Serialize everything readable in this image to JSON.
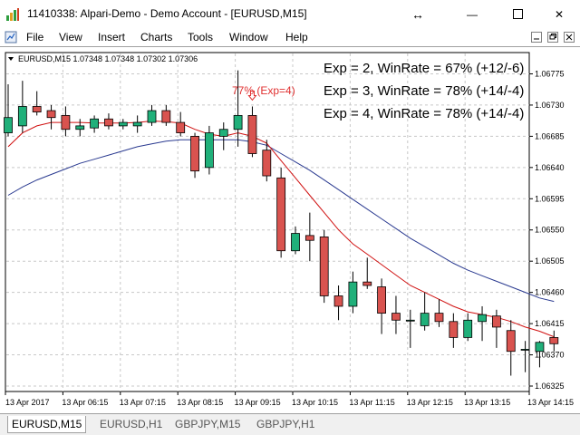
{
  "window": {
    "title": "11410338: Alpari-Demo - Demo Account - [EURUSD,M15]",
    "resize_glyph": "↔",
    "minimize_glyph": "—",
    "close_glyph": "✕"
  },
  "menu": {
    "items": [
      "File",
      "View",
      "Insert",
      "Charts",
      "Tools",
      "Window",
      "Help"
    ]
  },
  "chart": {
    "header": "EURUSD,M15  1.07348 1.07348 1.07302 1.07306",
    "annotation": "77% (Exp=4)",
    "annotation_color": "#e03030",
    "stats": [
      "Exp = 2, WinRate = 67% (+12/-6)",
      "Exp = 3, WinRate = 78% (+14/-4)",
      "Exp = 4, WinRate = 78% (+14/-4)"
    ],
    "colors": {
      "bull": "#20b07a",
      "bear": "#d9534f",
      "fast_ma": "#d01010",
      "slow_ma": "#2a3a90",
      "grid": "#c8c8c8"
    }
  },
  "chart_data": {
    "type": "candlestick",
    "symbol": "EURUSD",
    "timeframe": "M15",
    "ylim": [
      1.06325,
      1.0679
    ],
    "y_ticks": [
      "1.06775",
      "1.06730",
      "1.06685",
      "1.06640",
      "1.06595",
      "1.06550",
      "1.06505",
      "1.06460",
      "1.06415",
      "1.06370",
      "1.06325"
    ],
    "x_ticks": [
      "13 Apr 2017",
      "13 Apr 06:15",
      "13 Apr 07:15",
      "13 Apr 08:15",
      "13 Apr 09:15",
      "13 Apr 10:15",
      "13 Apr 11:15",
      "13 Apr 12:15",
      "13 Apr 13:15",
      "13 Apr 14:15"
    ],
    "candles": [
      {
        "o": 1.0669,
        "h": 1.0676,
        "l": 1.06685,
        "c": 1.06712
      },
      {
        "o": 1.067,
        "h": 1.06765,
        "l": 1.0669,
        "c": 1.06728
      },
      {
        "o": 1.06728,
        "h": 1.0675,
        "l": 1.06715,
        "c": 1.0672
      },
      {
        "o": 1.06722,
        "h": 1.0673,
        "l": 1.06695,
        "c": 1.06712
      },
      {
        "o": 1.06715,
        "h": 1.06728,
        "l": 1.06685,
        "c": 1.06695
      },
      {
        "o": 1.06695,
        "h": 1.0671,
        "l": 1.06685,
        "c": 1.067
      },
      {
        "o": 1.06697,
        "h": 1.06715,
        "l": 1.0669,
        "c": 1.0671
      },
      {
        "o": 1.0671,
        "h": 1.06718,
        "l": 1.06695,
        "c": 1.067
      },
      {
        "o": 1.067,
        "h": 1.0671,
        "l": 1.06695,
        "c": 1.06705
      },
      {
        "o": 1.067,
        "h": 1.06715,
        "l": 1.0669,
        "c": 1.06705
      },
      {
        "o": 1.06705,
        "h": 1.0673,
        "l": 1.067,
        "c": 1.06722
      },
      {
        "o": 1.06722,
        "h": 1.0673,
        "l": 1.067,
        "c": 1.06705
      },
      {
        "o": 1.06705,
        "h": 1.0672,
        "l": 1.06685,
        "c": 1.0669
      },
      {
        "o": 1.06685,
        "h": 1.0669,
        "l": 1.06625,
        "c": 1.06635
      },
      {
        "o": 1.0664,
        "h": 1.067,
        "l": 1.0663,
        "c": 1.0669
      },
      {
        "o": 1.06685,
        "h": 1.06705,
        "l": 1.06665,
        "c": 1.06695
      },
      {
        "o": 1.06695,
        "h": 1.0678,
        "l": 1.0667,
        "c": 1.06715
      },
      {
        "o": 1.06715,
        "h": 1.06728,
        "l": 1.06655,
        "c": 1.0666
      },
      {
        "o": 1.06665,
        "h": 1.0668,
        "l": 1.0662,
        "c": 1.06628
      },
      {
        "o": 1.06625,
        "h": 1.0664,
        "l": 1.0651,
        "c": 1.0652
      },
      {
        "o": 1.0652,
        "h": 1.06555,
        "l": 1.06515,
        "c": 1.06545
      },
      {
        "o": 1.06542,
        "h": 1.06575,
        "l": 1.06505,
        "c": 1.06535
      },
      {
        "o": 1.0654,
        "h": 1.0655,
        "l": 1.06445,
        "c": 1.06455
      },
      {
        "o": 1.06455,
        "h": 1.0647,
        "l": 1.0642,
        "c": 1.0644
      },
      {
        "o": 1.0644,
        "h": 1.0649,
        "l": 1.0643,
        "c": 1.06475
      },
      {
        "o": 1.06475,
        "h": 1.0651,
        "l": 1.06465,
        "c": 1.0647
      },
      {
        "o": 1.06468,
        "h": 1.0648,
        "l": 1.064,
        "c": 1.0643
      },
      {
        "o": 1.0643,
        "h": 1.06455,
        "l": 1.064,
        "c": 1.0642
      },
      {
        "o": 1.0642,
        "h": 1.06435,
        "l": 1.0638,
        "c": 1.0642
      },
      {
        "o": 1.06412,
        "h": 1.0646,
        "l": 1.06405,
        "c": 1.0643
      },
      {
        "o": 1.0643,
        "h": 1.0645,
        "l": 1.0641,
        "c": 1.06418
      },
      {
        "o": 1.06418,
        "h": 1.0643,
        "l": 1.0638,
        "c": 1.06395
      },
      {
        "o": 1.06395,
        "h": 1.0643,
        "l": 1.0639,
        "c": 1.0642
      },
      {
        "o": 1.06418,
        "h": 1.0644,
        "l": 1.0639,
        "c": 1.06428
      },
      {
        "o": 1.06426,
        "h": 1.06435,
        "l": 1.0638,
        "c": 1.0641
      },
      {
        "o": 1.06405,
        "h": 1.0642,
        "l": 1.0634,
        "c": 1.06375
      },
      {
        "o": 1.06378,
        "h": 1.0639,
        "l": 1.06345,
        "c": 1.06378
      },
      {
        "o": 1.06375,
        "h": 1.0639,
        "l": 1.06352,
        "c": 1.06388
      },
      {
        "o": 1.06395,
        "h": 1.06405,
        "l": 1.06375,
        "c": 1.06386
      }
    ],
    "fast_ma": [
      1.0667,
      1.0669,
      1.067,
      1.06705,
      1.06705,
      1.06705,
      1.06704,
      1.06704,
      1.06704,
      1.06705,
      1.06707,
      1.06706,
      1.06704,
      1.06695,
      1.06688,
      1.06685,
      1.0669,
      1.06685,
      1.06675,
      1.0665,
      1.06625,
      1.066,
      1.06575,
      1.0655,
      1.0653,
      1.06515,
      1.065,
      1.06485,
      1.0647,
      1.0646,
      1.0645,
      1.0644,
      1.06432,
      1.06428,
      1.06424,
      1.06418,
      1.0641,
      1.06404,
      1.06396
    ],
    "slow_ma": [
      1.066,
      1.06612,
      1.06622,
      1.0663,
      1.06638,
      1.06646,
      1.06652,
      1.06658,
      1.06664,
      1.0667,
      1.06674,
      1.06678,
      1.0668,
      1.0668,
      1.0668,
      1.0668,
      1.0668,
      1.06677,
      1.06672,
      1.0666,
      1.06648,
      1.06636,
      1.06622,
      1.06608,
      1.06594,
      1.0658,
      1.06566,
      1.06552,
      1.06538,
      1.06526,
      1.06514,
      1.06502,
      1.06492,
      1.06484,
      1.06476,
      1.06468,
      1.0646,
      1.06452,
      1.06447
    ],
    "signal": {
      "index": 16,
      "direction": "down"
    }
  },
  "tabs": [
    {
      "label": "EURUSD,M15",
      "active": true
    },
    {
      "label": "EURUSD,H1",
      "active": false
    },
    {
      "label": "GBPJPY,M15",
      "active": false
    },
    {
      "label": "GBPJPY,H1",
      "active": false
    }
  ]
}
